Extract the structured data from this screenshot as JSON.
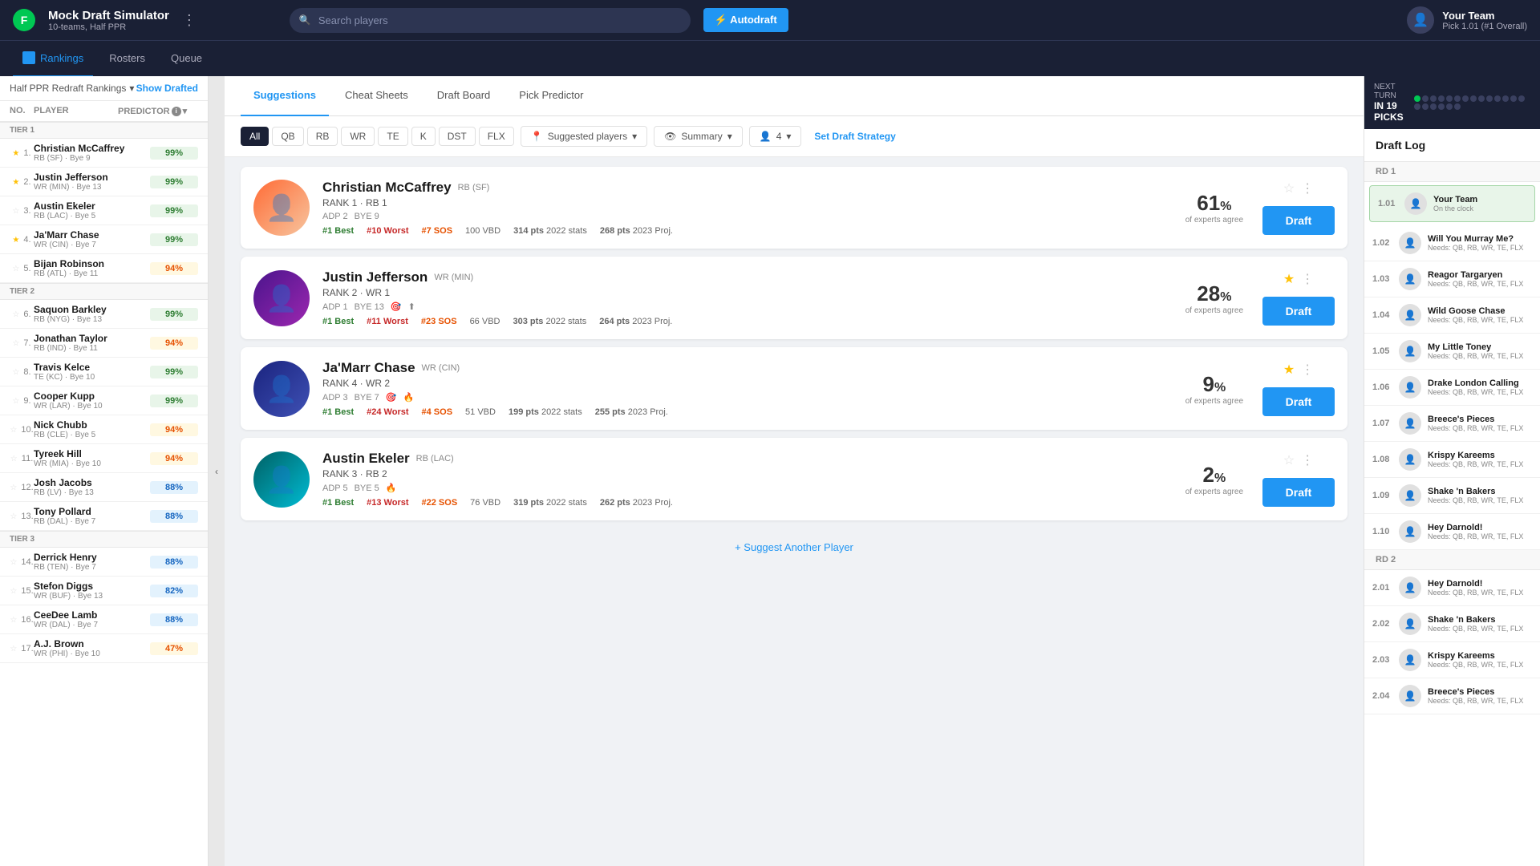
{
  "app": {
    "logo": "F",
    "title": "Mock Draft Simulator",
    "subtitle": "10-teams, Half PPR",
    "menu_icon": "⋮"
  },
  "search": {
    "placeholder": "Search players"
  },
  "autodraft": {
    "label": "⚡ Autodraft"
  },
  "your_team": {
    "name": "Your Team",
    "pick": "Pick 1.01 (#1 Overall)"
  },
  "sub_nav": {
    "items": [
      {
        "id": "rankings",
        "label": "Rankings",
        "active": true
      },
      {
        "id": "rosters",
        "label": "Rosters",
        "active": false
      },
      {
        "id": "queue",
        "label": "Queue",
        "active": false
      }
    ]
  },
  "sidebar": {
    "dropdown_label": "Half PPR Redraft Rankings",
    "show_drafted": "Show Drafted",
    "columns": {
      "no": "NO.",
      "player": "PLAYER",
      "predictor": "PREDICTOR"
    },
    "tiers": [
      {
        "label": "Tier 1",
        "players": [
          {
            "num": "1.",
            "name": "Christian McCaffrey",
            "meta": "RB (SF) · Bye 9",
            "score": "99%",
            "score_type": "green",
            "starred": true,
            "icons": [
              "🔶"
            ]
          },
          {
            "num": "2.",
            "name": "Justin Jefferson",
            "meta": "WR (MIN) · Bye 13",
            "score": "99%",
            "score_type": "green",
            "starred": true,
            "icons": [
              "🎯",
              "⬆"
            ]
          },
          {
            "num": "3.",
            "name": "Austin Ekeler",
            "meta": "RB (LAC) · Bye 5",
            "score": "99%",
            "score_type": "green",
            "starred": false,
            "icons": [
              "🔥"
            ]
          },
          {
            "num": "4.",
            "name": "Ja'Marr Chase",
            "meta": "WR (CIN) · Bye 7",
            "score": "99%",
            "score_type": "green",
            "starred": true,
            "icons": [
              "🎯",
              "🔥"
            ]
          },
          {
            "num": "5.",
            "name": "Bijan Robinson",
            "meta": "RB (ATL) · Bye 11",
            "score": "94%",
            "score_type": "yellow",
            "starred": false,
            "icons": [
              "🔵",
              "🆕"
            ]
          }
        ]
      },
      {
        "label": "Tier 2",
        "players": [
          {
            "num": "6.",
            "name": "Saquon Barkley",
            "meta": "RB (NYG) · Bye 13",
            "score": "99%",
            "score_type": "green",
            "starred": false,
            "icons": [
              "⬆",
              "🎯"
            ]
          },
          {
            "num": "7.",
            "name": "Jonathan Taylor",
            "meta": "RB (IND) · Bye 11",
            "score": "94%",
            "score_type": "yellow",
            "starred": false,
            "icons": [
              "❄",
              "🔴"
            ]
          },
          {
            "num": "8.",
            "name": "Travis Kelce",
            "meta": "TE (KC) · Bye 10",
            "score": "99%",
            "score_type": "green",
            "starred": false,
            "icons": [
              "🔥"
            ]
          },
          {
            "num": "9.",
            "name": "Cooper Kupp",
            "meta": "WR (LAR) · Bye 10",
            "score": "99%",
            "score_type": "green",
            "starred": false,
            "icons": []
          },
          {
            "num": "10.",
            "name": "Nick Chubb",
            "meta": "RB (CLE) · Bye 5",
            "score": "94%",
            "score_type": "yellow",
            "starred": false,
            "icons": [
              "🚫"
            ]
          },
          {
            "num": "11.",
            "name": "Tyreek Hill",
            "meta": "WR (MIA) · Bye 10",
            "score": "94%",
            "score_type": "yellow",
            "starred": false,
            "icons": [
              "🔥",
              "🔥",
              "🎯"
            ]
          },
          {
            "num": "12.",
            "name": "Josh Jacobs",
            "meta": "RB (LV) · Bye 13",
            "score": "88%",
            "score_type": "blue",
            "starred": false,
            "icons": []
          },
          {
            "num": "13.",
            "name": "Tony Pollard",
            "meta": "RB (DAL) · Bye 7",
            "score": "88%",
            "score_type": "blue",
            "starred": false,
            "icons": [
              "⬆",
              "⬆"
            ]
          }
        ]
      },
      {
        "label": "Tier 3",
        "players": [
          {
            "num": "14.",
            "name": "Derrick Henry",
            "meta": "RB (TEN) · Bye 7",
            "score": "88%",
            "score_type": "blue",
            "starred": false,
            "icons": [
              "❄"
            ]
          },
          {
            "num": "15.",
            "name": "Stefon Diggs",
            "meta": "WR (BUF) · Bye 13",
            "score": "82%",
            "score_type": "blue",
            "starred": false,
            "icons": []
          },
          {
            "num": "16.",
            "name": "CeeDee Lamb",
            "meta": "WR (DAL) · Bye 7",
            "score": "88%",
            "score_type": "blue",
            "starred": false,
            "icons": [
              "⬆"
            ]
          },
          {
            "num": "17.",
            "name": "A.J. Brown",
            "meta": "WR (PHI) · Bye 10",
            "score": "47%",
            "score_type": "yellow",
            "starred": false,
            "icons": [
              "🔥"
            ]
          }
        ]
      }
    ]
  },
  "center_tabs": {
    "items": [
      {
        "id": "suggestions",
        "label": "Suggestions",
        "active": true
      },
      {
        "id": "cheat-sheets",
        "label": "Cheat Sheets",
        "active": false
      },
      {
        "id": "draft-board",
        "label": "Draft Board",
        "active": false
      },
      {
        "id": "pick-predictor",
        "label": "Pick Predictor",
        "active": false
      }
    ]
  },
  "position_filters": [
    "All",
    "QB",
    "RB",
    "WR",
    "TE",
    "K",
    "DST",
    "FLX"
  ],
  "active_filter": "All",
  "filter_dropdowns": {
    "players": "Suggested players",
    "view": "Summary",
    "count": "4"
  },
  "set_strategy": "Set Draft Strategy",
  "player_cards": [
    {
      "id": "mccaffrey",
      "name": "Christian McCaffrey",
      "pos": "RB",
      "team": "SF",
      "rank_label": "RANK 1 · RB 1",
      "adp": "ADP 2",
      "bye": "BYE 9",
      "best": "#1 Best",
      "worst": "#10 Worst",
      "sos": "#7 SOS",
      "vbd": "100 VBD",
      "pts_2022": "314 pts",
      "pts_2022_label": "2022 stats",
      "pts_2023": "268 pts",
      "pts_2023_label": "2023 Proj.",
      "expert_pct": "61",
      "expert_label": "of experts agree",
      "draft_btn": "Draft",
      "starred": false,
      "photo_class": "photo-mccaffrey",
      "photo_icon": "👤"
    },
    {
      "id": "jefferson",
      "name": "Justin Jefferson",
      "pos": "WR",
      "team": "MIN",
      "rank_label": "RANK 2 · WR 1",
      "adp": "ADP 1",
      "bye": "BYE 13",
      "best": "#1 Best",
      "worst": "#11 Worst",
      "sos": "#23 SOS",
      "vbd": "66 VBD",
      "pts_2022": "303 pts",
      "pts_2022_label": "2022 stats",
      "pts_2023": "264 pts",
      "pts_2023_label": "2023 Proj.",
      "expert_pct": "28",
      "expert_label": "of experts agree",
      "draft_btn": "Draft",
      "starred": true,
      "photo_class": "photo-jefferson",
      "photo_icon": "👤"
    },
    {
      "id": "chase",
      "name": "Ja'Marr Chase",
      "pos": "WR",
      "team": "CIN",
      "rank_label": "RANK 4 · WR 2",
      "adp": "ADP 3",
      "bye": "BYE 7",
      "best": "#1 Best",
      "worst": "#24 Worst",
      "sos": "#4 SOS",
      "vbd": "51 VBD",
      "pts_2022": "199 pts",
      "pts_2022_label": "2022 stats",
      "pts_2023": "255 pts",
      "pts_2023_label": "2023 Proj.",
      "expert_pct": "9",
      "expert_label": "of experts agree",
      "draft_btn": "Draft",
      "starred": true,
      "photo_class": "photo-chase",
      "photo_icon": "👤"
    },
    {
      "id": "ekeler",
      "name": "Austin Ekeler",
      "pos": "RB",
      "team": "LAC",
      "rank_label": "RANK 3 · RB 2",
      "adp": "ADP 5",
      "bye": "BYE 5",
      "best": "#1 Best",
      "worst": "#13 Worst",
      "sos": "#22 SOS",
      "vbd": "76 VBD",
      "pts_2022": "319 pts",
      "pts_2022_label": "2022 stats",
      "pts_2023": "262 pts",
      "pts_2023_label": "2023 Proj.",
      "expert_pct": "2",
      "expert_label": "of experts agree",
      "draft_btn": "Draft",
      "starred": false,
      "photo_class": "photo-ekeler",
      "photo_icon": "👤"
    }
  ],
  "suggest_another": "+ Suggest Another Player",
  "right_panel": {
    "next_turn_label": "NEXT TURN",
    "in_picks": "IN 19 PICKS",
    "draft_log_title": "Draft Log",
    "rounds": [
      {
        "label": "RD 1",
        "picks": [
          {
            "num": "1.01",
            "team": "Your Team",
            "detail": "On the clock",
            "highlighted": true
          },
          {
            "num": "1.02",
            "team": "Will You Murray Me?",
            "detail": "Needs: QB, RB, WR, TE, FLX",
            "highlighted": false
          },
          {
            "num": "1.03",
            "team": "Reagor Targaryen",
            "detail": "Needs: QB, RB, WR, TE, FLX",
            "highlighted": false
          },
          {
            "num": "1.04",
            "team": "Wild Goose Chase",
            "detail": "Needs: QB, RB, WR, TE, FLX",
            "highlighted": false
          },
          {
            "num": "1.05",
            "team": "My Little Toney",
            "detail": "Needs: QB, RB, WR, TE, FLX",
            "highlighted": false
          },
          {
            "num": "1.06",
            "team": "Drake London Calling",
            "detail": "Needs: QB, RB, WR, TE, FLX",
            "highlighted": false
          },
          {
            "num": "1.07",
            "team": "Breece's Pieces",
            "detail": "Needs: QB, RB, WR, TE, FLX",
            "highlighted": false
          },
          {
            "num": "1.08",
            "team": "Krispy Kareems",
            "detail": "Needs: QB, RB, WR, TE, FLX",
            "highlighted": false
          },
          {
            "num": "1.09",
            "team": "Shake 'n Bakers",
            "detail": "Needs: QB, RB, WR, TE, FLX",
            "highlighted": false
          },
          {
            "num": "1.10",
            "team": "Hey Darnold!",
            "detail": "Needs: QB, RB, WR, TE, FLX",
            "highlighted": false
          }
        ]
      },
      {
        "label": "RD 2",
        "picks": [
          {
            "num": "2.01",
            "team": "Hey Darnold!",
            "detail": "Needs: QB, RB, WR, TE, FLX",
            "highlighted": false
          },
          {
            "num": "2.02",
            "team": "Shake 'n Bakers",
            "detail": "Needs: QB, RB, WR, TE, FLX",
            "highlighted": false
          },
          {
            "num": "2.03",
            "team": "Krispy Kareems",
            "detail": "Needs: QB, RB, WR, TE, FLX",
            "highlighted": false
          },
          {
            "num": "2.04",
            "team": "Breece's Pieces",
            "detail": "Needs: QB, RB, WR, TE, FLX",
            "highlighted": false
          }
        ]
      }
    ]
  }
}
